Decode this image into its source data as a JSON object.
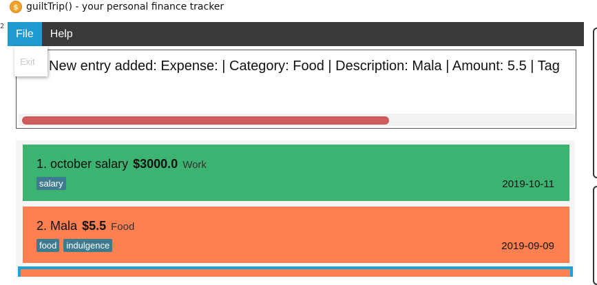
{
  "window": {
    "title": "guiltTrip() - your personal finance tracker",
    "icon": "coin-icon"
  },
  "menubar": {
    "items": [
      {
        "label": "File",
        "active": true
      },
      {
        "label": "Help",
        "active": false
      }
    ],
    "file_menu": {
      "items": [
        "Exit"
      ]
    }
  },
  "result_display": {
    "text": "New entry added: Expense:  | Category: Food | Description: Mala | Amount: 5.5 | Tag",
    "scroll_fraction": 0.66
  },
  "entries": [
    {
      "index": "1.",
      "description": "october salary",
      "amount": "$3000.0",
      "category": "Work",
      "tags": [
        "salary"
      ],
      "date": "2019-10-11",
      "color": "#3cb371"
    },
    {
      "index": "2.",
      "description": "Mala",
      "amount": "$5.5",
      "category": "Food",
      "tags": [
        "food",
        "indulgence"
      ],
      "date": "2019-09-09",
      "color": "#fe8050"
    }
  ],
  "colors": {
    "menubar": "#3a3a3a",
    "menu_active": "#1f9bd1",
    "tag": "#3e7b91",
    "scrollbar_thumb": "#cd5c5c",
    "selection_border": "#1aa3d6"
  }
}
